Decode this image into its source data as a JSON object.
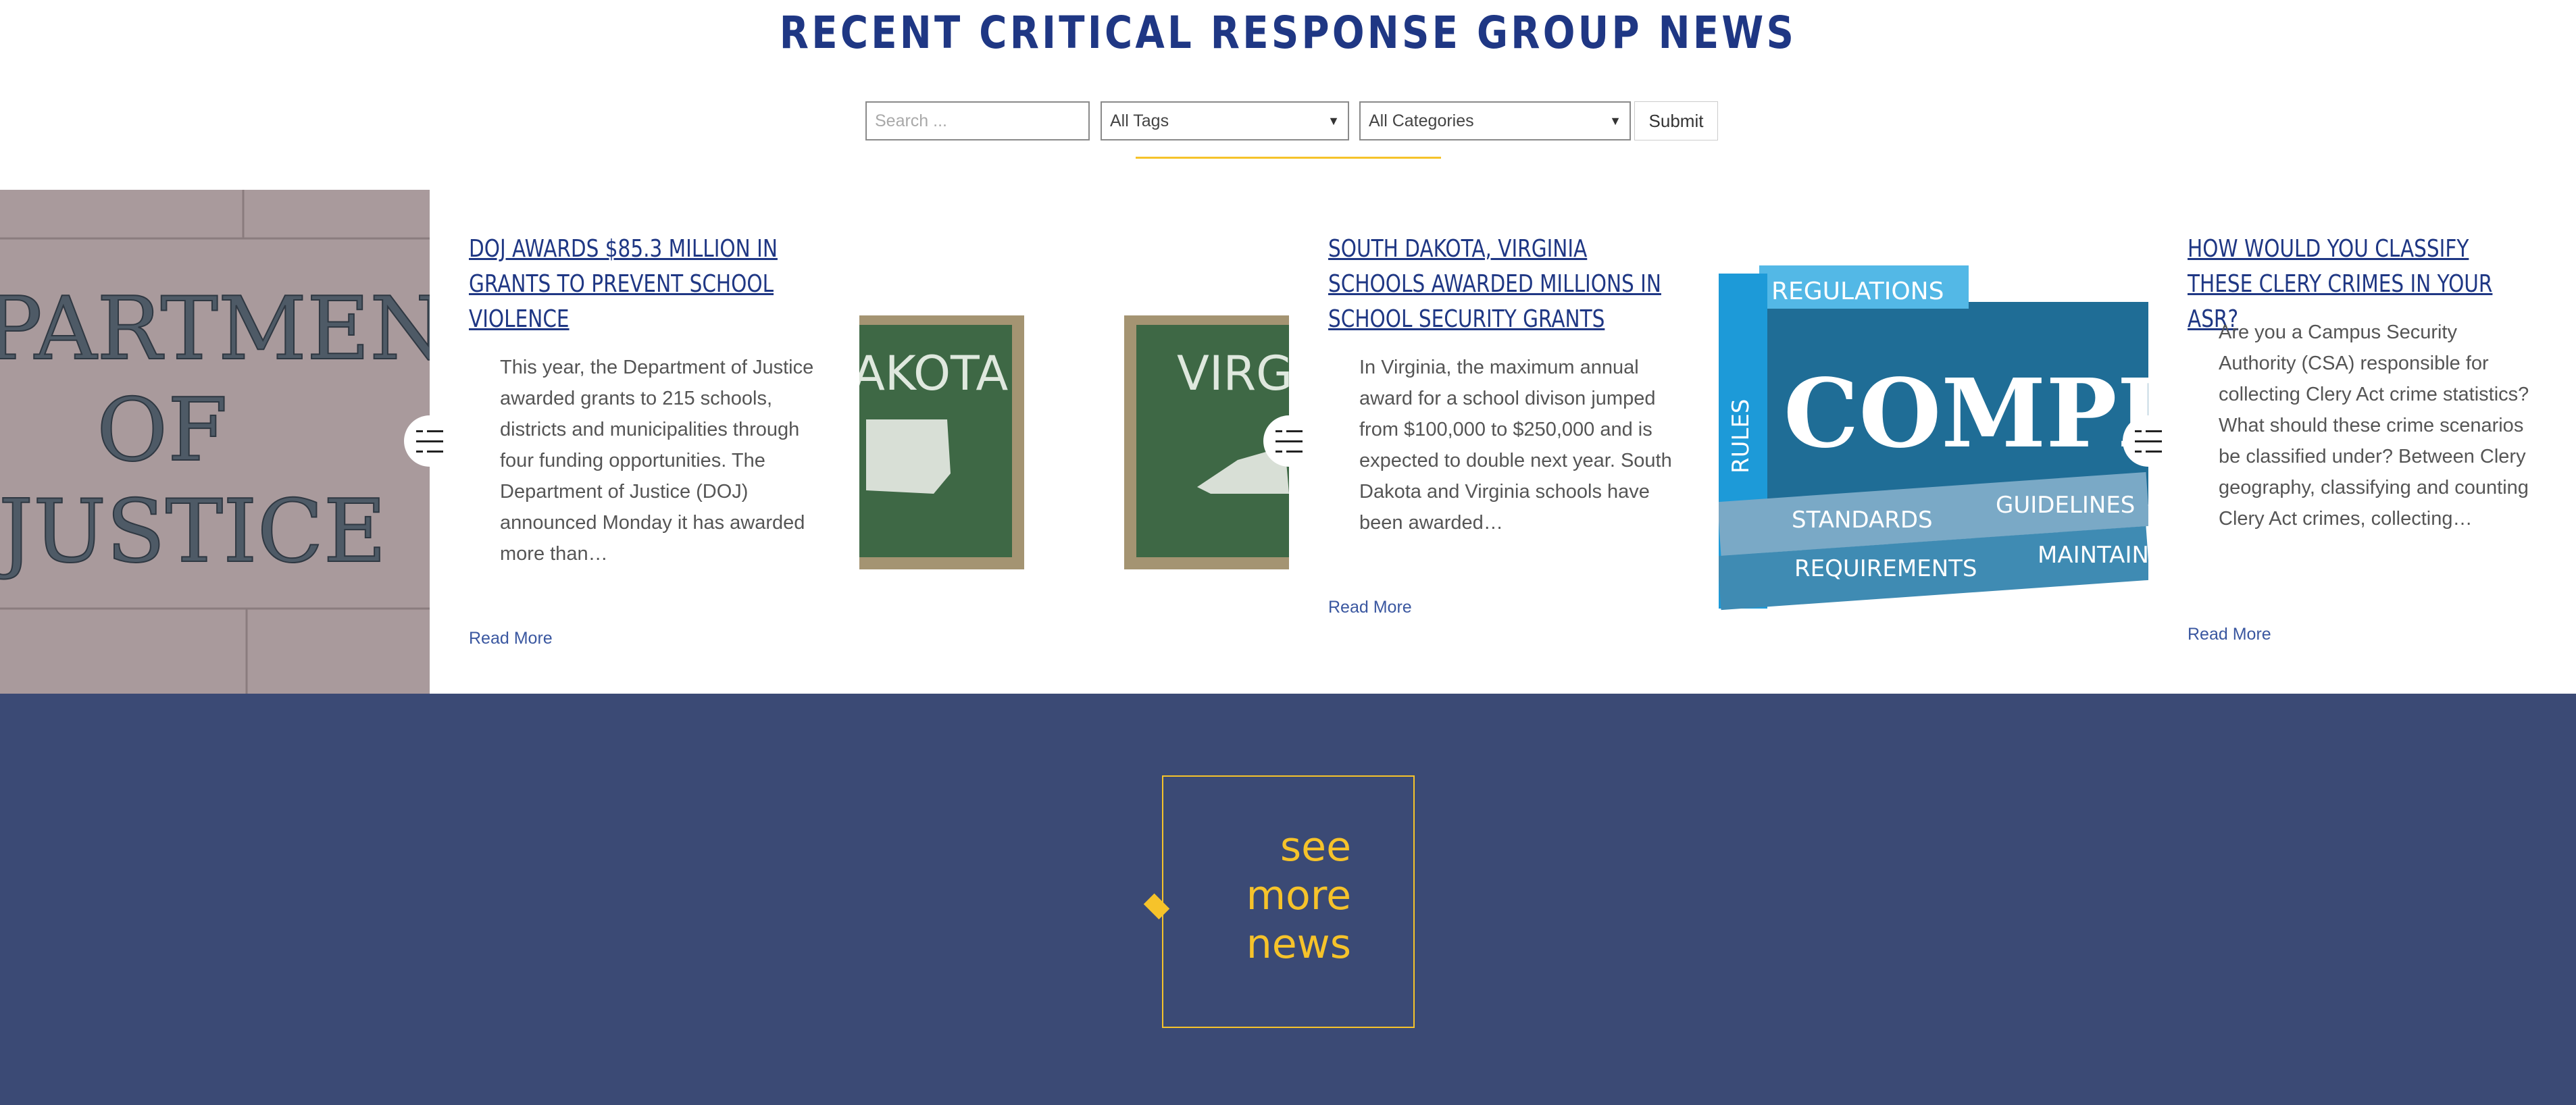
{
  "page": {
    "title": "RECENT CRITICAL RESPONSE GROUP NEWS"
  },
  "filters": {
    "search_placeholder": "Search ...",
    "tags_value": "All Tags",
    "categories_value": "All Categories",
    "submit_label": "Submit"
  },
  "articles": [
    {
      "image_alt": "Department of Justice engraved stone",
      "image_text": [
        "PARTMEN",
        "OF",
        "JUSTICE"
      ],
      "title": "DOJ AWARDS $85.3 MILLION IN GRANTS TO PREVENT SCHOOL VIOLENCE",
      "excerpt": "This year, the Department of Justice awarded grants to 215 schools, districts and municipalities through four funding opportunities. The Department of Justice (DOJ) announced Monday it has awarded more than…",
      "read_more": "Read More"
    },
    {
      "image_alt": "Chalkboards showing South Dakota and Virginia",
      "image_text": [
        "AKOTA",
        "VIRG"
      ],
      "title": "SOUTH DAKOTA, VIRGINIA SCHOOLS AWARDED MILLIONS IN SCHOOL SECURITY GRANTS",
      "excerpt": "In Virginia, the maximum annual award for a school divison jumped from $100,000 to $250,000 and is expected to double next year. South Dakota and Virginia schools have been awarded…",
      "read_more": "Read More"
    },
    {
      "image_alt": "Compliance word graphic",
      "image_text": [
        "REGULATIONS",
        "RULES",
        "COMPLI",
        "STANDARDS",
        "GUIDELINES",
        "REQUIREMENTS",
        "MAINTAIN"
      ],
      "title": "HOW WOULD YOU CLASSIFY THESE CLERY CRIMES IN YOUR ASR?",
      "excerpt": "Are you a Campus Security Authority (CSA) responsible for collecting Clery Act crime statistics? What should these crime scenarios be classified under? Between Clery geography, classifying and counting Clery Act crimes, collecting…",
      "read_more": "Read More"
    }
  ],
  "see_more": {
    "line1": "see",
    "line2": "more",
    "line3": "news"
  },
  "colors": {
    "brand_blue": "#1f3784",
    "band_navy": "#3b4a75",
    "accent_yellow": "#f6c32a",
    "link_blue": "#3a57a0"
  }
}
